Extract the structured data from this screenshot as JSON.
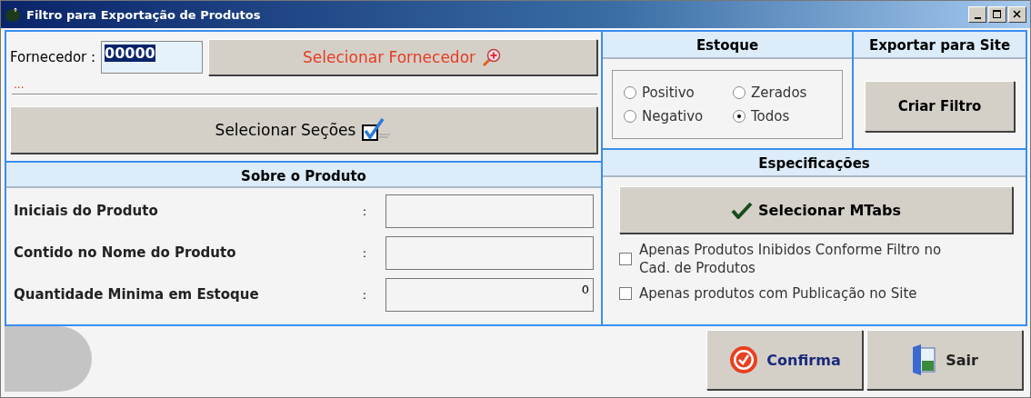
{
  "window": {
    "title": "Filtro para Exportação de Produtos"
  },
  "fornecedor": {
    "label": "Fornecedor :",
    "value": "00000",
    "button": "Selecionar Fornecedor",
    "name": "..."
  },
  "secoes_button": "Selecionar Seções",
  "produto": {
    "title": "Sobre o Produto",
    "fields": [
      {
        "label": "Iniciais do Produto",
        "colon": ":"
      },
      {
        "label": "Contido no Nome do Produto",
        "colon": ":"
      },
      {
        "label": "Quantidade Minima em Estoque",
        "colon": ":",
        "value": "0"
      }
    ]
  },
  "estoque": {
    "title": "Estoque",
    "options": [
      {
        "label": "Positivo",
        "selected": false
      },
      {
        "label": "Zerados",
        "selected": false
      },
      {
        "label": "Negativo",
        "selected": false
      },
      {
        "label": "Todos",
        "selected": true
      }
    ]
  },
  "exportar": {
    "title": "Exportar para Site",
    "button": "Criar Filtro"
  },
  "especificacoes": {
    "title": "Especificações",
    "button": "Selecionar MTabs",
    "checks": [
      {
        "label": "Apenas Produtos Inibidos Conforme Filtro no Cad. de Produtos",
        "checked": false
      },
      {
        "label": "Apenas produtos com Publicação no Site",
        "checked": false
      }
    ]
  },
  "buttons": [
    {
      "kind": "confirm",
      "label": "Confirma"
    },
    {
      "kind": "exit",
      "label": "Sair"
    }
  ]
}
